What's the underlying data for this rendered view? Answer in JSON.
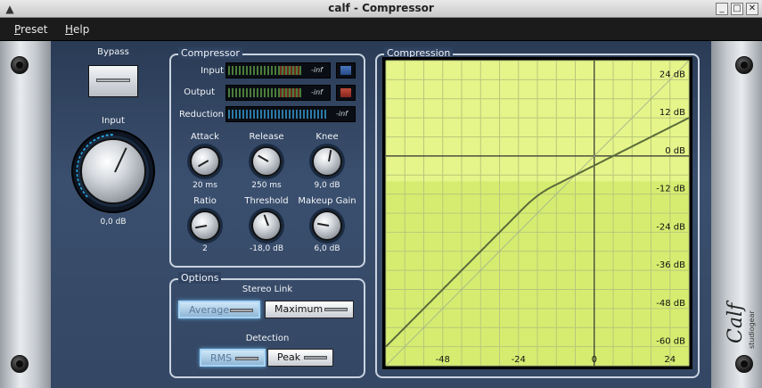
{
  "window": {
    "title": "calf - Compressor",
    "buttons": [
      "_",
      "□",
      "✕"
    ]
  },
  "menu": [
    {
      "label": "Preset"
    },
    {
      "label": "Help"
    }
  ],
  "left": {
    "bypass_label": "Bypass",
    "input_label": "Input",
    "input_value": "0,0 dB"
  },
  "compressor": {
    "title": "Compressor",
    "meters": [
      {
        "label": "Input",
        "value": "-inf"
      },
      {
        "label": "Output",
        "value": "-inf"
      },
      {
        "label": "Reduction",
        "value": "-inf"
      }
    ],
    "knobs": [
      {
        "label": "Attack",
        "value": "20 ms"
      },
      {
        "label": "Release",
        "value": "250 ms"
      },
      {
        "label": "Knee",
        "value": "9,0 dB"
      },
      {
        "label": "Ratio",
        "value": "2"
      },
      {
        "label": "Threshold",
        "value": "-18,0 dB"
      },
      {
        "label": "Makeup Gain",
        "value": "6,0 dB"
      }
    ]
  },
  "options": {
    "title": "Options",
    "stereo_link_label": "Stereo Link",
    "stereo_link": [
      "Average",
      "Maximum"
    ],
    "stereo_link_selected": "Average",
    "detection_label": "Detection",
    "detection": [
      "RMS",
      "Peak"
    ],
    "detection_selected": "RMS"
  },
  "graph": {
    "title": "Compression",
    "y_ticks": [
      "24 dB",
      "12 dB",
      "0 dB",
      "-12 dB",
      "-24 dB",
      "-36 dB",
      "-48 dB",
      "-60 dB"
    ],
    "x_ticks": [
      "-48",
      "-24",
      "0",
      "24"
    ]
  },
  "logo": {
    "text": "Calf",
    "subtext": "studiogear"
  },
  "colors": {
    "graph_bg": "#e6f58a",
    "graph_bg_reduced": "#d6ec70",
    "curve": "#5b6b3a",
    "panel": "#344764"
  }
}
